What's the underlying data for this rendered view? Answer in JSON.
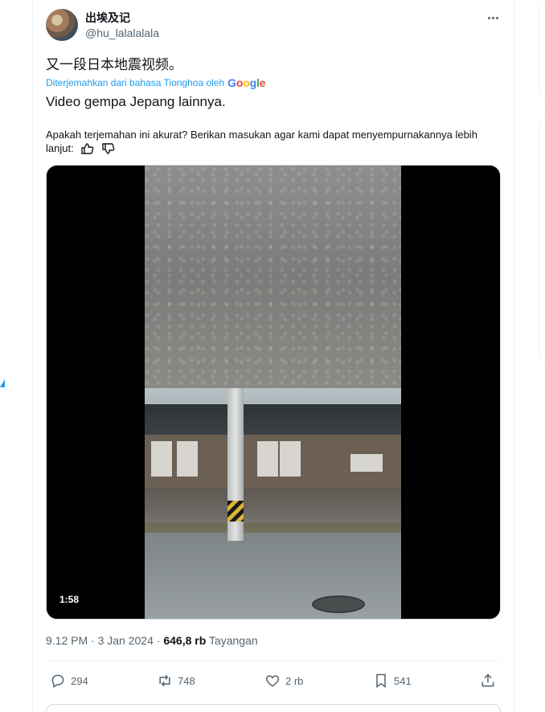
{
  "author": {
    "name": "出埃及记",
    "handle": "@hu_lalalalala"
  },
  "tweet": {
    "original_text": "又一段日本地震视频。",
    "translated_by_prefix": "Diterjemahkan dari bahasa Tionghoa oleh",
    "translated_by_brand": "Google",
    "translated_text": "Video gempa Jepang lainnya.",
    "feedback_question": "Apakah terjemahan ini akurat? Berikan masukan agar kami dapat menyempurnakannya lebih lanjut:"
  },
  "media": {
    "duration": "1:58"
  },
  "meta": {
    "time": "9.12 PM",
    "separator": "·",
    "date": "3 Jan 2024",
    "views_value": "646,8 rb",
    "views_label": "Tayangan"
  },
  "actions": {
    "replies": "294",
    "reposts": "748",
    "likes": "2 rb",
    "bookmarks": "541"
  },
  "colors": {
    "accent": "#1d9bf0",
    "text_secondary": "#536471"
  }
}
